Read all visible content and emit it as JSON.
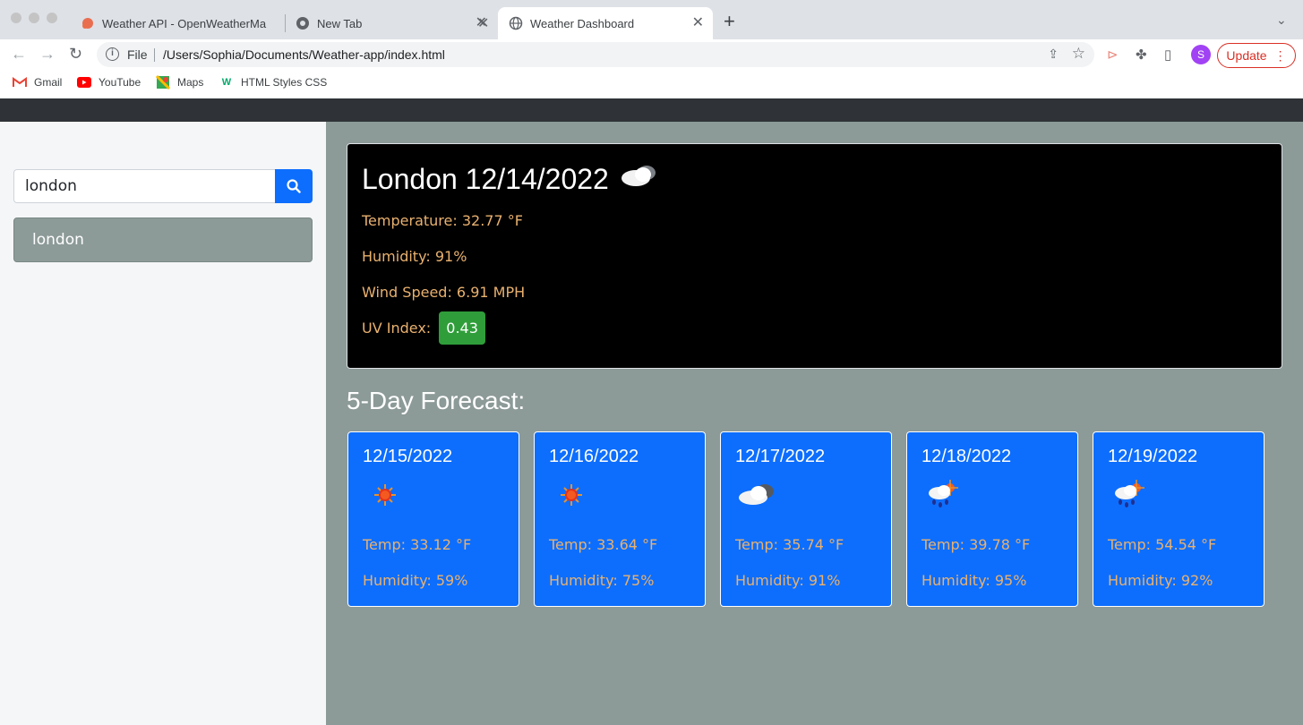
{
  "browser": {
    "tabs": [
      {
        "title": "Weather API - OpenWeatherMa",
        "icon": "openweather-icon"
      },
      {
        "title": "New Tab",
        "icon": "chrome-icon"
      },
      {
        "title": "Weather Dashboard",
        "icon": "globe-icon"
      }
    ],
    "omnibox": {
      "scheme": "File",
      "url": "/Users/Sophia/Documents/Weather-app/index.html"
    },
    "profile_initial": "S",
    "update_label": "Update",
    "bookmarks": [
      {
        "label": "Gmail"
      },
      {
        "label": "YouTube"
      },
      {
        "label": "Maps"
      },
      {
        "label": "HTML Styles CSS"
      }
    ]
  },
  "sidebar": {
    "search_value": "london",
    "history": [
      "london"
    ]
  },
  "current": {
    "city": "London",
    "date": "12/14/2022",
    "icon": "cloud-icon",
    "temperature": "Temperature: 32.77 °F",
    "humidity": "Humidity: 91%",
    "wind": "Wind Speed: 6.91 MPH",
    "uv_label": "UV Index:",
    "uv_value": "0.43",
    "uv_color": "#2f9e3a"
  },
  "forecast": {
    "title": "5-Day Forecast:",
    "days": [
      {
        "date": "12/15/2022",
        "icon": "sun-icon",
        "temp": "Temp: 33.12 °F",
        "humidity": "Humidity: 59%"
      },
      {
        "date": "12/16/2022",
        "icon": "sun-icon",
        "temp": "Temp: 33.64 °F",
        "humidity": "Humidity: 75%"
      },
      {
        "date": "12/17/2022",
        "icon": "cloud-icon",
        "temp": "Temp: 35.74 °F",
        "humidity": "Humidity: 91%"
      },
      {
        "date": "12/18/2022",
        "icon": "rain-sun-icon",
        "temp": "Temp: 39.78 °F",
        "humidity": "Humidity: 95%"
      },
      {
        "date": "12/19/2022",
        "icon": "rain-sun-icon",
        "temp": "Temp: 54.54 °F",
        "humidity": "Humidity: 92%"
      }
    ]
  },
  "colors": {
    "accent": "#0d6efd",
    "text_warm": "#e9b16f",
    "panel": "#8c9a98"
  }
}
